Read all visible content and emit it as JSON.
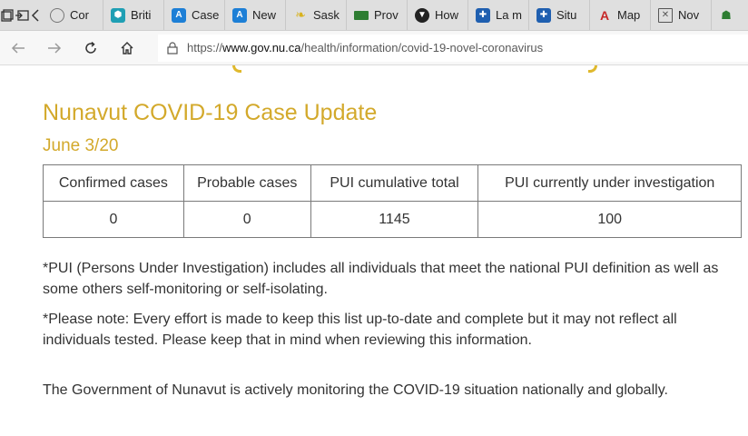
{
  "browser": {
    "tabs": [
      {
        "label": "Cor",
        "icon": "circle-c-icon"
      },
      {
        "label": "Briti",
        "icon": "hexagon-icon"
      },
      {
        "label": "Case",
        "icon": "blue-a-icon"
      },
      {
        "label": "New",
        "icon": "blue-a-icon"
      },
      {
        "label": "Sask",
        "icon": "leaf-icon"
      },
      {
        "label": "Prov",
        "icon": "green-banner-icon"
      },
      {
        "label": "How",
        "icon": "shield-icon"
      },
      {
        "label": "La m",
        "icon": "fleur-de-lis-icon"
      },
      {
        "label": "Situ",
        "icon": "fleur-de-lis-icon"
      },
      {
        "label": "Map",
        "icon": "red-a-icon"
      },
      {
        "label": "Nov",
        "icon": "image-icon"
      }
    ],
    "url": {
      "scheme": "https://",
      "host": "www.gov.nu.ca",
      "path": "/health/information/covid-19-novel-coronavirus"
    }
  },
  "page": {
    "title": "Nunavut COVID-19 Case Update",
    "date": "June 3/20",
    "table": {
      "headers": [
        "Confirmed cases",
        "Probable cases",
        "PUI cumulative total",
        "PUI currently under investigation"
      ],
      "rows": [
        [
          "0",
          "0",
          "1145",
          "100"
        ]
      ]
    },
    "note1": "*PUI (Persons Under Investigation) includes all individuals that meet the national PUI definition as well as some others self-monitoring or self-isolating.",
    "note2": "*Please note: Every effort is made to keep this list up-to-date and complete but it may not reflect all individuals tested. Please keep that in mind when reviewing this information.",
    "monitoring": "The Government of Nunavut is actively monitoring the COVID-19 situation nationally and globally."
  },
  "colors": {
    "heading": "#d3a92b",
    "accent_deco": "#e0b92d"
  }
}
